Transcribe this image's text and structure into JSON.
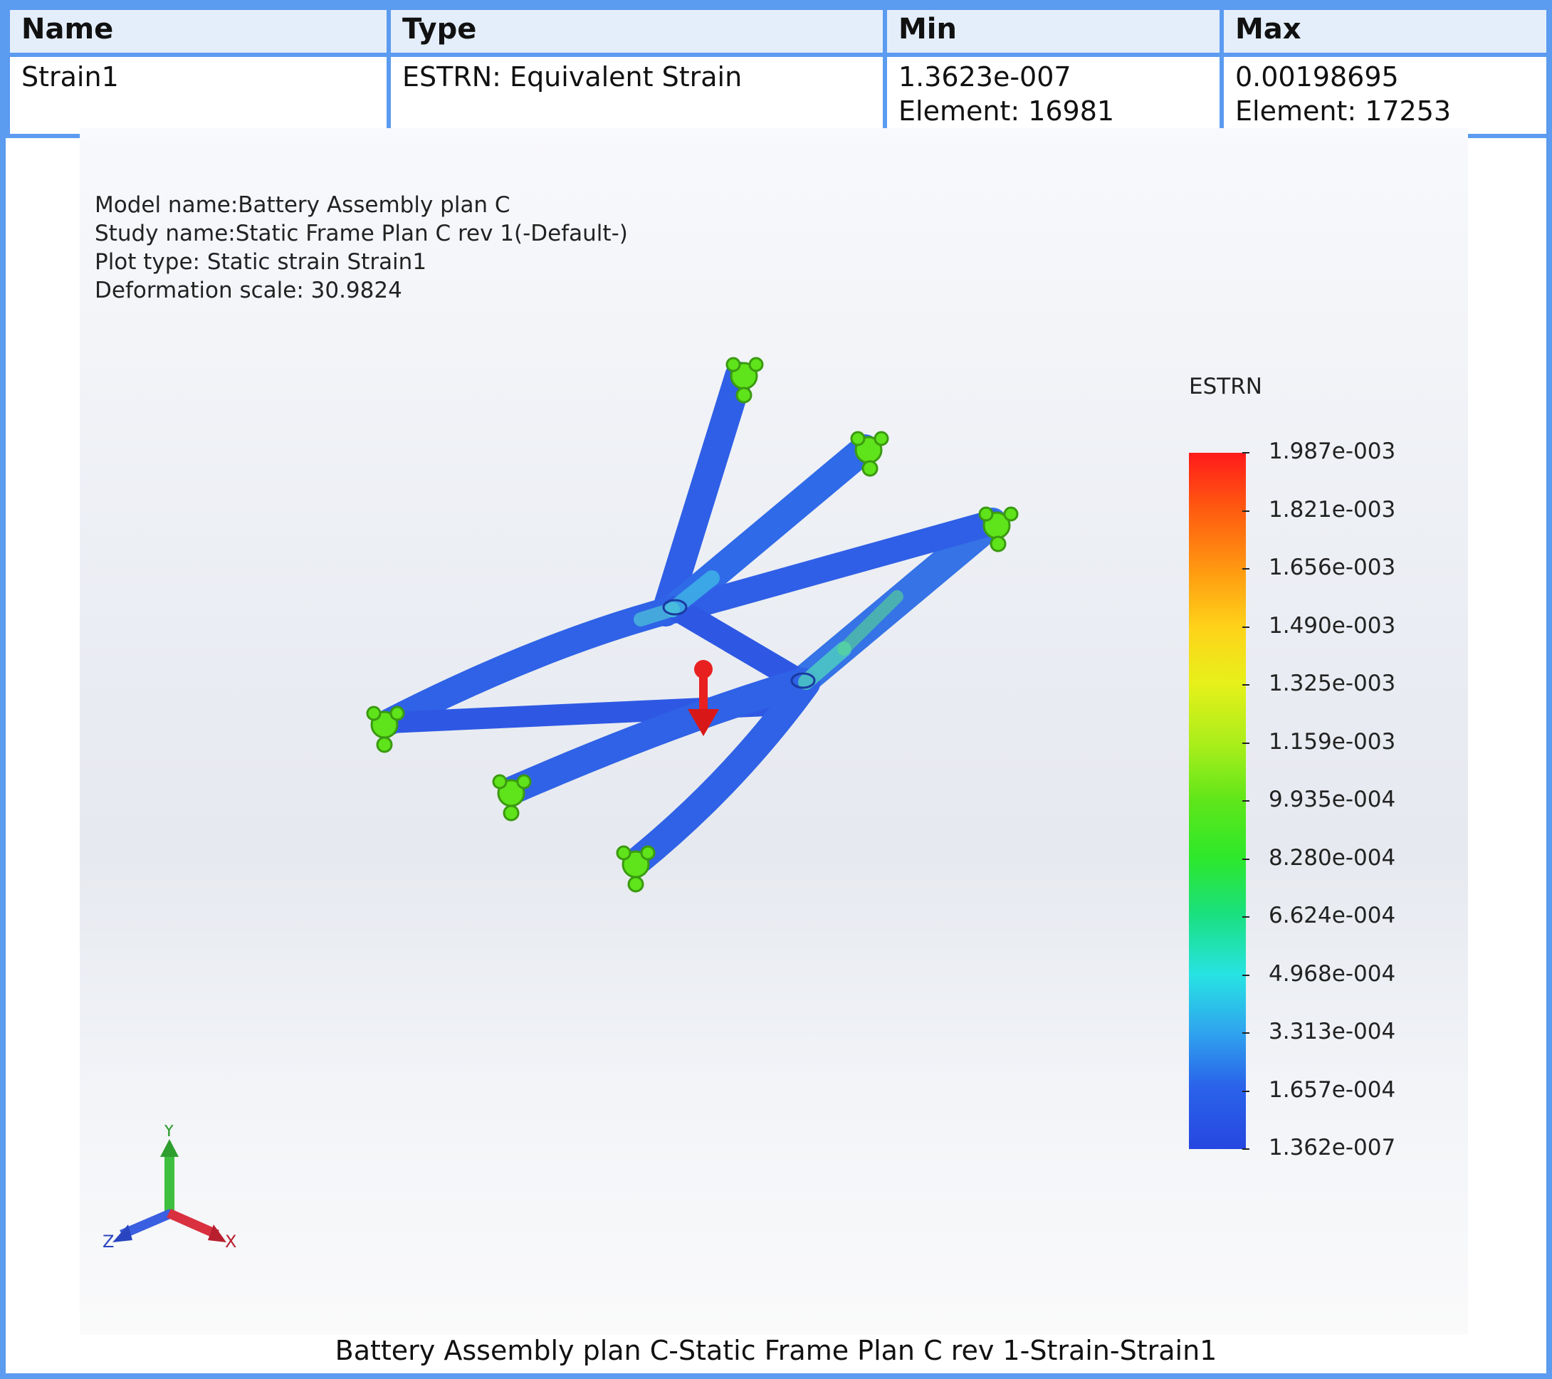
{
  "table": {
    "headers": {
      "name": "Name",
      "type": "Type",
      "min": "Min",
      "max": "Max"
    },
    "row": {
      "name": "Strain1",
      "type": "ESTRN: Equivalent Strain",
      "min_value": "1.3623e-007",
      "min_element": "Element: 16981",
      "max_value": "0.00198695",
      "max_element": "Element: 17253"
    }
  },
  "info": {
    "model_name": "Model name:Battery Assembly plan C",
    "study_name": "Study name:Static Frame Plan C rev 1(-Default-)",
    "plot_type": "Plot type: Static strain Strain1",
    "deformation_scale": "Deformation scale: 30.9824"
  },
  "legend": {
    "title": "ESTRN",
    "labels": [
      "1.987e-003",
      "1.821e-003",
      "1.656e-003",
      "1.490e-003",
      "1.325e-003",
      "1.159e-003",
      "9.935e-004",
      "8.280e-004",
      "6.624e-004",
      "4.968e-004",
      "3.313e-004",
      "1.657e-004",
      "1.362e-007"
    ]
  },
  "triad": {
    "y": "Y",
    "z": "Z",
    "x": "X"
  },
  "caption": "Battery Assembly plan C-Static Frame Plan C rev 1-Strain-Strain1",
  "colors": {
    "border": "#5b9bf0",
    "header_bg": "#e4eefa",
    "beam": "#2f62e6",
    "fixture": "#5fe31a",
    "load": "#e82020"
  }
}
